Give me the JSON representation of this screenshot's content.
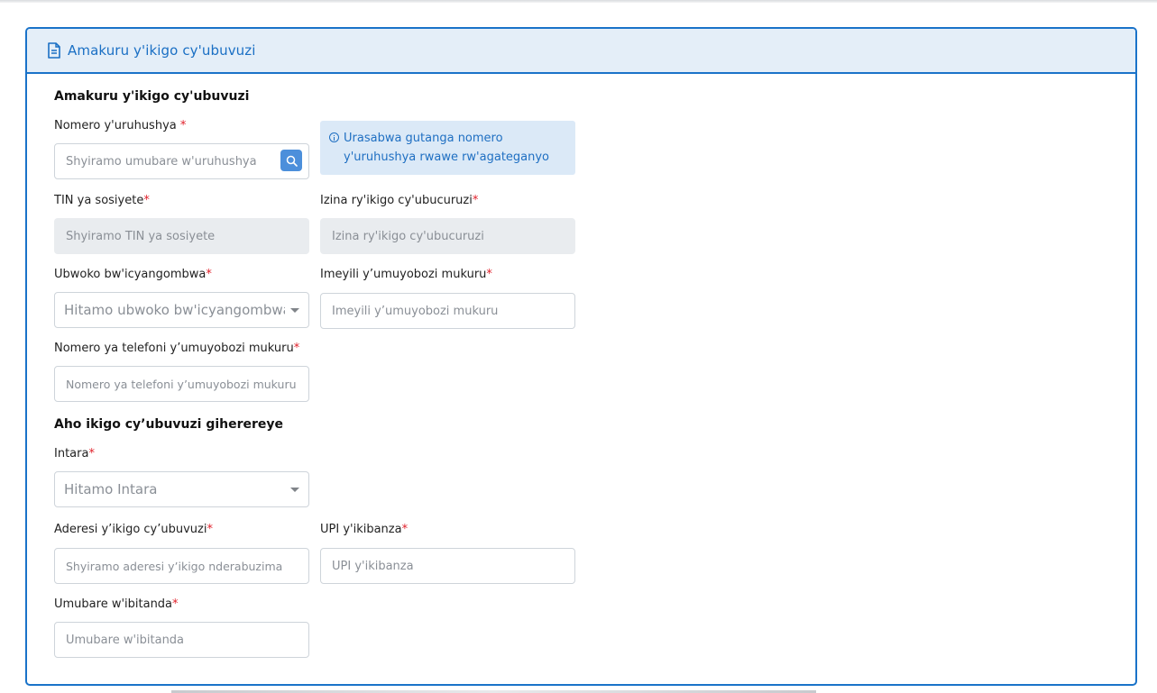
{
  "header": {
    "title": "Amakuru y'ikigo cy'ubuvuzi",
    "icon": "document-icon"
  },
  "section_facility": {
    "title": "Amakuru y'ikigo cy'ubuvuzi"
  },
  "license": {
    "label": "Nomero y'uruhushya",
    "required": "*",
    "placeholder": "Shyiramo umubare w'uruhushya",
    "search_icon": "search-icon"
  },
  "info": {
    "line1": "Urasabwa gutanga nomero",
    "line2": "y'uruhushya rwawe rw'agateganyo",
    "icon": "info-circle-icon"
  },
  "tin": {
    "label": "TIN ya sosiyete",
    "required": "*",
    "placeholder": "Shyiramo TIN ya sosiyete"
  },
  "business_name": {
    "label": "Izina ry'ikigo cy'ubucuruzi",
    "required": "*",
    "placeholder": "Izina ry'ikigo cy'ubucuruzi"
  },
  "facility_type": {
    "label": "Ubwoko bw'icyangombwa",
    "required": "*",
    "selected": "Hitamo ubwoko bw'icyangombwa"
  },
  "manager_email": {
    "label": "Imeyili y’umuyobozi mukuru",
    "required": "*",
    "placeholder": "Imeyili y’umuyobozi mukuru"
  },
  "manager_phone": {
    "label": "Nomero ya telefoni y’umuyobozi mukuru",
    "required": "*",
    "placeholder": "Nomero ya telefoni y’umuyobozi mukuru"
  },
  "section_location": {
    "title": "Aho ikigo cy’ubuvuzi giherereye"
  },
  "province": {
    "label": "Intara",
    "required": "*",
    "selected": "Hitamo Intara"
  },
  "address": {
    "label": "Aderesi y’ikigo cy’ubuvuzi",
    "required": "*",
    "placeholder": "Shyiramo aderesi y’ikigo nderabuzima"
  },
  "upi": {
    "label": "UPI y'ikibanza",
    "required": "*",
    "placeholder": "UPI y'ikibanza"
  },
  "beds": {
    "label": "Umubare w'ibitanda",
    "required": "*",
    "placeholder": "Umubare w'ibitanda"
  },
  "colors": {
    "accent": "#1a73c9",
    "header_bg": "#e4eef8",
    "info_bg": "#dbe9f7",
    "required": "#e0202a",
    "search_button": "#4c8fdb"
  }
}
